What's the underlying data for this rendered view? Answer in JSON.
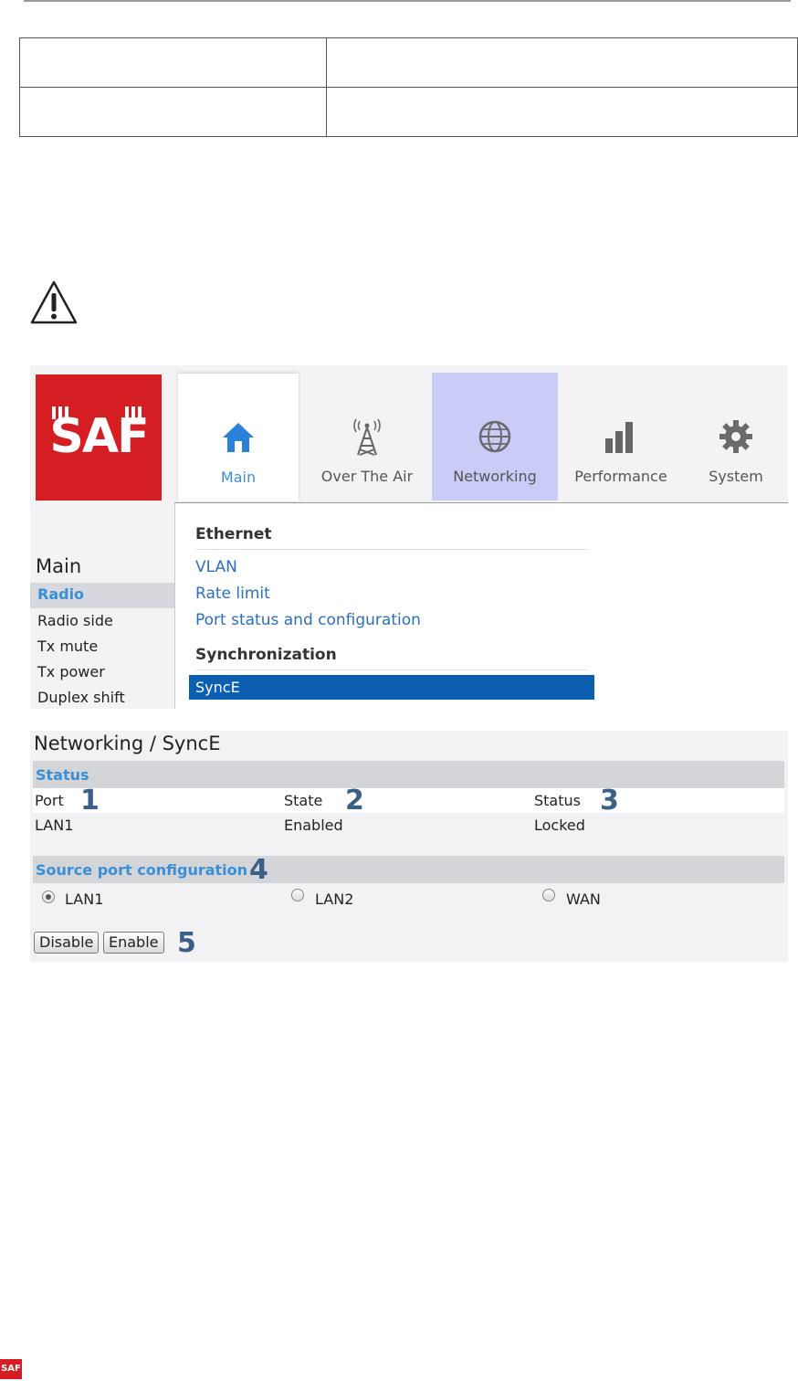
{
  "doc_table": {
    "rows": [
      [
        "",
        ""
      ],
      [
        "",
        ""
      ]
    ]
  },
  "logo": {
    "text": "SAF"
  },
  "tabs": [
    {
      "label": "Main",
      "icon": "home-icon",
      "selected": true
    },
    {
      "label": "Over The Air",
      "icon": "antenna-tower-icon"
    },
    {
      "label": "Networking",
      "icon": "globe-icon",
      "highlighted": true
    },
    {
      "label": "Performance",
      "icon": "bar-chart-icon"
    },
    {
      "label": "System",
      "icon": "gear-icon"
    }
  ],
  "sidebar": {
    "heading": "Main",
    "items": [
      "Radio",
      "Radio side",
      "Tx mute",
      "Tx power",
      "Duplex shift"
    ]
  },
  "dropdown": {
    "sections": [
      {
        "heading": "Ethernet",
        "items": [
          "VLAN",
          "Rate limit",
          "Port status and configuration"
        ]
      },
      {
        "heading": "Synchronization",
        "items": [
          "SyncE"
        ]
      }
    ]
  },
  "panel": {
    "title": "Networking / SyncE",
    "status_section": "Status",
    "columns": [
      "Port",
      "State",
      "Status"
    ],
    "row": [
      "LAN1",
      "Enabled",
      "Locked"
    ],
    "source_section": "Source port configuration",
    "radios": [
      {
        "label": "LAN1",
        "checked": true
      },
      {
        "label": "LAN2",
        "checked": false
      },
      {
        "label": "WAN",
        "checked": false
      }
    ],
    "buttons": {
      "disable": "Disable",
      "enable": "Enable"
    },
    "callouts": [
      "1",
      "2",
      "3",
      "4",
      "5"
    ]
  },
  "colors": {
    "brand_red": "#d41e23",
    "link_blue": "#3a8fd8",
    "selected_blue": "#0b5eb0",
    "networking_tab": "#c8ccf6"
  }
}
